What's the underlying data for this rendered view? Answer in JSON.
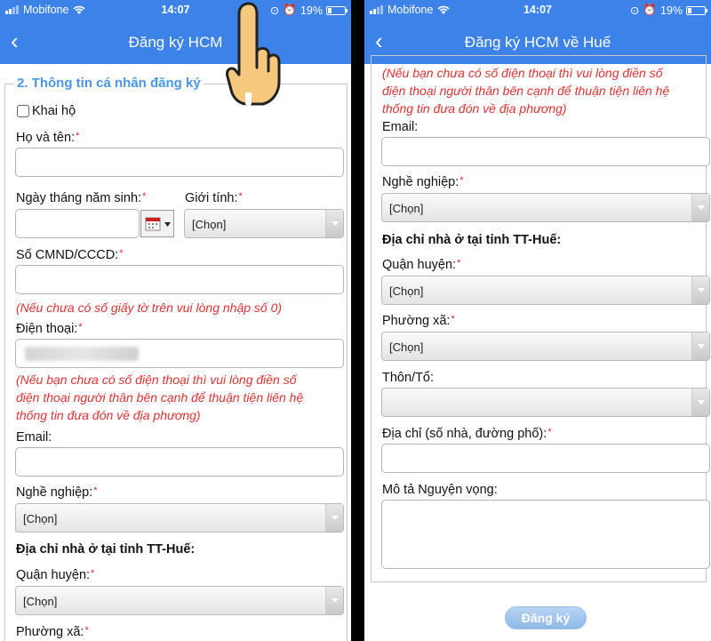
{
  "status": {
    "carrier": "Mobifone",
    "time": "14:07",
    "battery": "19%",
    "battery_level": 0.19
  },
  "left": {
    "nav_title": "Đăng ký HCM",
    "section_legend": "2. Thông tin cá nhân đăng ký",
    "khai_ho_label": "Khai hộ",
    "ho_ten_label": "Họ và tên:",
    "ngay_sinh_label": "Ngày tháng năm sinh:",
    "gioi_tinh_label": "Giới tính:",
    "gioi_tinh_value": "[Chọn]",
    "cmnd_label": "Số CMND/CCCD:",
    "cmnd_hint": "(Nếu chưa có số giấy tờ trên vui lòng nhập số 0)",
    "dien_thoai_label": "Điện thoại:",
    "phone_hint_1": "(Nếu bạn chưa có số điện thoại thì vui lòng điền số",
    "phone_hint_2": "điện thoại người thân bên cạnh để thuận tiện liên hệ",
    "phone_hint_3": "thống tin đưa đón về địa phương)",
    "email_label": "Email:",
    "nghe_nghiep_label": "Nghề nghiệp:",
    "nghe_nghiep_value": "[Chọn]",
    "address_section": "Địa chỉ nhà ở tại tỉnh TT-Huế:",
    "quan_huyen_label": "Quận huyện:",
    "quan_huyen_value": "[Chọn]",
    "phuong_xa_label": "Phường xã:"
  },
  "right": {
    "nav_title": "Đăng ký HCM về Huế",
    "phone_hint_1": "(Nếu bạn chưa có số điện thoại thì vui lòng điền số",
    "phone_hint_2": "điện thoại người thân bên cạnh để thuận tiện liên hệ",
    "phone_hint_3": "thống tin đưa đón về địa phương)",
    "email_label": "Email:",
    "nghe_nghiep_label": "Nghề nghiệp:",
    "nghe_nghiep_value": "[Chọn]",
    "address_section": "Địa chỉ nhà ở tại tỉnh TT-Huế:",
    "quan_huyen_label": "Quận huyện:",
    "quan_huyen_value": "[Chọn]",
    "phuong_xa_label": "Phường xã:",
    "phuong_xa_value": "[Chọn]",
    "thon_to_label": "Thôn/Tổ:",
    "dia_chi_label": "Địa chỉ (số nhà, đường phố):",
    "mo_ta_label": "Mô tả Nguyện vọng:",
    "submit_label": "Đăng ký"
  },
  "required_mark": "*",
  "colors": {
    "header_blue": "#3c82e8",
    "legend_blue": "#4a97e8",
    "required_red": "#d62a2a",
    "submit_blue": "#8fb8e8"
  },
  "icons": [
    "back-chevron-icon",
    "wifi-icon",
    "signal-icon",
    "battery-icon",
    "calendar-icon",
    "dropdown-arrow-icon",
    "pointing-hand-icon"
  ]
}
